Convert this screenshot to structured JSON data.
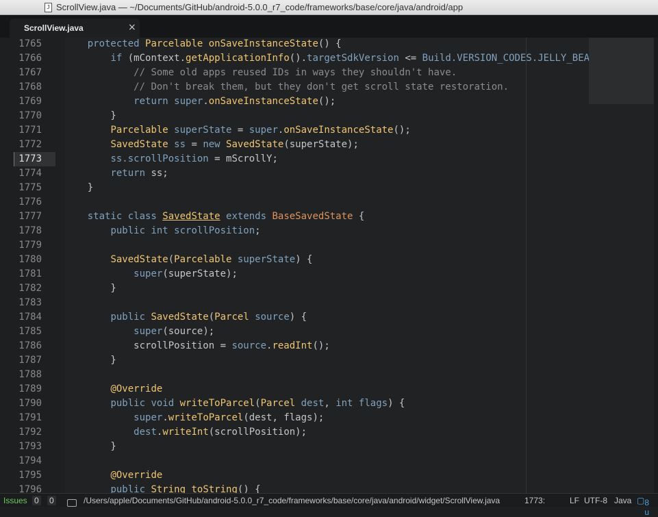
{
  "window": {
    "title": "ScrollView.java — ~/Documents/GitHub/android-5.0.0_r7_code/frameworks/base/core/java/android/app"
  },
  "tab": {
    "label": "ScrollView.java",
    "close": "×"
  },
  "editor": {
    "current_line": "1773",
    "lines": [
      {
        "n": "1765",
        "tokens": [
          [
            "pl",
            "    "
          ],
          [
            "kw",
            "protected "
          ],
          [
            "ty",
            "Parcelable "
          ],
          [
            "fn",
            "onSaveInstanceState"
          ],
          [
            "pl",
            "() {"
          ]
        ]
      },
      {
        "n": "1766",
        "tokens": [
          [
            "pl",
            "        "
          ],
          [
            "kw",
            "if "
          ],
          [
            "pl",
            "(mContext."
          ],
          [
            "fn",
            "getApplicationInfo"
          ],
          [
            "pl",
            "()."
          ],
          [
            "kw",
            "targetSdkVersion "
          ],
          [
            "pl",
            "<= "
          ],
          [
            "kw",
            "Build.VERSION_CODES.JELLY_BEA"
          ]
        ]
      },
      {
        "n": "1767",
        "tokens": [
          [
            "pl",
            "            "
          ],
          [
            "cm",
            "// Some old apps reused IDs in ways they shouldn't have."
          ]
        ]
      },
      {
        "n": "1768",
        "tokens": [
          [
            "pl",
            "            "
          ],
          [
            "cm",
            "// Don't break them, but they don't get scroll state restoration."
          ]
        ]
      },
      {
        "n": "1769",
        "tokens": [
          [
            "pl",
            "            "
          ],
          [
            "kw",
            "return "
          ],
          [
            "kw",
            "super"
          ],
          [
            "pl",
            "."
          ],
          [
            "fn",
            "onSaveInstanceState"
          ],
          [
            "pl",
            "();"
          ]
        ]
      },
      {
        "n": "1770",
        "tokens": [
          [
            "pl",
            "        }"
          ]
        ]
      },
      {
        "n": "1771",
        "tokens": [
          [
            "pl",
            "        "
          ],
          [
            "ty",
            "Parcelable "
          ],
          [
            "kw",
            "superState "
          ],
          [
            "pl",
            "= "
          ],
          [
            "kw",
            "super"
          ],
          [
            "pl",
            "."
          ],
          [
            "fn",
            "onSaveInstanceState"
          ],
          [
            "pl",
            "();"
          ]
        ]
      },
      {
        "n": "1772",
        "tokens": [
          [
            "pl",
            "        "
          ],
          [
            "ty",
            "SavedState "
          ],
          [
            "kw",
            "ss "
          ],
          [
            "pl",
            "= "
          ],
          [
            "kw",
            "new "
          ],
          [
            "ty",
            "SavedState"
          ],
          [
            "pl",
            "(superState);"
          ]
        ]
      },
      {
        "n": "1773",
        "tokens": [
          [
            "pl",
            "        "
          ],
          [
            "kw",
            "ss.scrollPosition "
          ],
          [
            "pl",
            "= mScrollY;"
          ]
        ]
      },
      {
        "n": "1774",
        "tokens": [
          [
            "pl",
            "        "
          ],
          [
            "kw",
            "return "
          ],
          [
            "pl",
            "ss;"
          ]
        ]
      },
      {
        "n": "1775",
        "tokens": [
          [
            "pl",
            "    }"
          ]
        ]
      },
      {
        "n": "1776",
        "tokens": []
      },
      {
        "n": "1777",
        "tokens": [
          [
            "pl",
            "    "
          ],
          [
            "kw",
            "static class "
          ],
          [
            "ul",
            "SavedState"
          ],
          [
            "pl",
            " "
          ],
          [
            "kw",
            "extends "
          ],
          [
            "ty2",
            "BaseSavedState "
          ],
          [
            "pl",
            "{"
          ]
        ]
      },
      {
        "n": "1778",
        "tokens": [
          [
            "pl",
            "        "
          ],
          [
            "kw",
            "public int "
          ],
          [
            "kw",
            "scrollPosition"
          ],
          [
            "pl",
            ";"
          ]
        ]
      },
      {
        "n": "1779",
        "tokens": []
      },
      {
        "n": "1780",
        "tokens": [
          [
            "pl",
            "        "
          ],
          [
            "fn",
            "SavedState"
          ],
          [
            "pl",
            "("
          ],
          [
            "ty",
            "Parcelable "
          ],
          [
            "kw",
            "superState"
          ],
          [
            "pl",
            ") {"
          ]
        ]
      },
      {
        "n": "1781",
        "tokens": [
          [
            "pl",
            "            "
          ],
          [
            "kw",
            "super"
          ],
          [
            "pl",
            "(superState);"
          ]
        ]
      },
      {
        "n": "1782",
        "tokens": [
          [
            "pl",
            "        }"
          ]
        ]
      },
      {
        "n": "1783",
        "tokens": []
      },
      {
        "n": "1784",
        "tokens": [
          [
            "pl",
            "        "
          ],
          [
            "kw",
            "public "
          ],
          [
            "fn",
            "SavedState"
          ],
          [
            "pl",
            "("
          ],
          [
            "ty",
            "Parcel "
          ],
          [
            "kw",
            "source"
          ],
          [
            "pl",
            ") {"
          ]
        ]
      },
      {
        "n": "1785",
        "tokens": [
          [
            "pl",
            "            "
          ],
          [
            "kw",
            "super"
          ],
          [
            "pl",
            "(source);"
          ]
        ]
      },
      {
        "n": "1786",
        "tokens": [
          [
            "pl",
            "            scrollPosition = "
          ],
          [
            "kw",
            "source"
          ],
          [
            "pl",
            "."
          ],
          [
            "fn",
            "readInt"
          ],
          [
            "pl",
            "();"
          ]
        ]
      },
      {
        "n": "1787",
        "tokens": [
          [
            "pl",
            "        }"
          ]
        ]
      },
      {
        "n": "1788",
        "tokens": []
      },
      {
        "n": "1789",
        "tokens": [
          [
            "pl",
            "        "
          ],
          [
            "an",
            "@Override"
          ]
        ]
      },
      {
        "n": "1790",
        "tokens": [
          [
            "pl",
            "        "
          ],
          [
            "kw",
            "public void "
          ],
          [
            "fn",
            "writeToParcel"
          ],
          [
            "pl",
            "("
          ],
          [
            "ty",
            "Parcel "
          ],
          [
            "kw",
            "dest"
          ],
          [
            "pl",
            ", "
          ],
          [
            "kw",
            "int "
          ],
          [
            "kw",
            "flags"
          ],
          [
            "pl",
            ") {"
          ]
        ]
      },
      {
        "n": "1791",
        "tokens": [
          [
            "pl",
            "            "
          ],
          [
            "kw",
            "super"
          ],
          [
            "pl",
            "."
          ],
          [
            "fn",
            "writeToParcel"
          ],
          [
            "pl",
            "(dest, flags);"
          ]
        ]
      },
      {
        "n": "1792",
        "tokens": [
          [
            "pl",
            "            "
          ],
          [
            "kw",
            "dest"
          ],
          [
            "pl",
            "."
          ],
          [
            "fn",
            "writeInt"
          ],
          [
            "pl",
            "(scrollPosition);"
          ]
        ]
      },
      {
        "n": "1793",
        "tokens": [
          [
            "pl",
            "        }"
          ]
        ]
      },
      {
        "n": "1794",
        "tokens": []
      },
      {
        "n": "1795",
        "tokens": [
          [
            "pl",
            "        "
          ],
          [
            "an",
            "@Override"
          ]
        ]
      },
      {
        "n": "1796",
        "tokens": [
          [
            "pl",
            "        "
          ],
          [
            "kw",
            "public "
          ],
          [
            "ty",
            "String "
          ],
          [
            "fn",
            "toString"
          ],
          [
            "pl",
            "() {"
          ]
        ]
      }
    ]
  },
  "status": {
    "issues_label": "Issues",
    "errors": "0",
    "warnings": "0",
    "path": "/Users/apple/Documents/GitHub/android-5.0.0_r7_code/frameworks/base/core/java/android/widget/ScrollView.java",
    "cursor": "1773:",
    "line_ending": "LF",
    "encoding": "UTF-8",
    "grammar": "Java",
    "updates": "8 u"
  },
  "colors": {
    "background": "#1d1f21",
    "keyword": "#81a2be",
    "type": "#f0c674",
    "comment": "#8c8c8c",
    "issues": "#6ccb5f"
  }
}
